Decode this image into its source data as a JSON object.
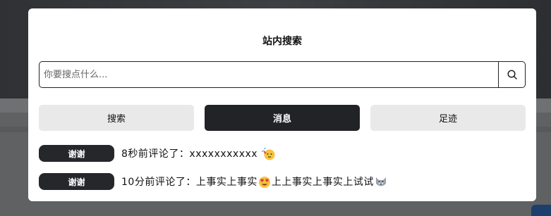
{
  "modal": {
    "title": "站内搜索",
    "search": {
      "placeholder": "你要搜点什么...",
      "value": ""
    },
    "tabs": [
      {
        "label": "搜索",
        "active": false
      },
      {
        "label": "消息",
        "active": true
      },
      {
        "label": "足迹",
        "active": false
      }
    ],
    "messages": [
      {
        "badge": "谢谢",
        "prefix": "8秒前评论了：",
        "text_before": "xxxxxxxxxxx",
        "emoji_1": "party-face-emoji",
        "text_after": "",
        "emoji_2": ""
      },
      {
        "badge": "谢谢",
        "prefix": "10分前评论了：",
        "text_before": "上事实上事实",
        "emoji_1": "heart-eyes-emoji",
        "text_after": "上上事实上事实上试试",
        "emoji_2": "wolf-face-emoji"
      }
    ]
  },
  "colors": {
    "accent_dark": "#212327",
    "tab_bg": "#e9e9e9",
    "modal_bg": "#ffffff"
  }
}
